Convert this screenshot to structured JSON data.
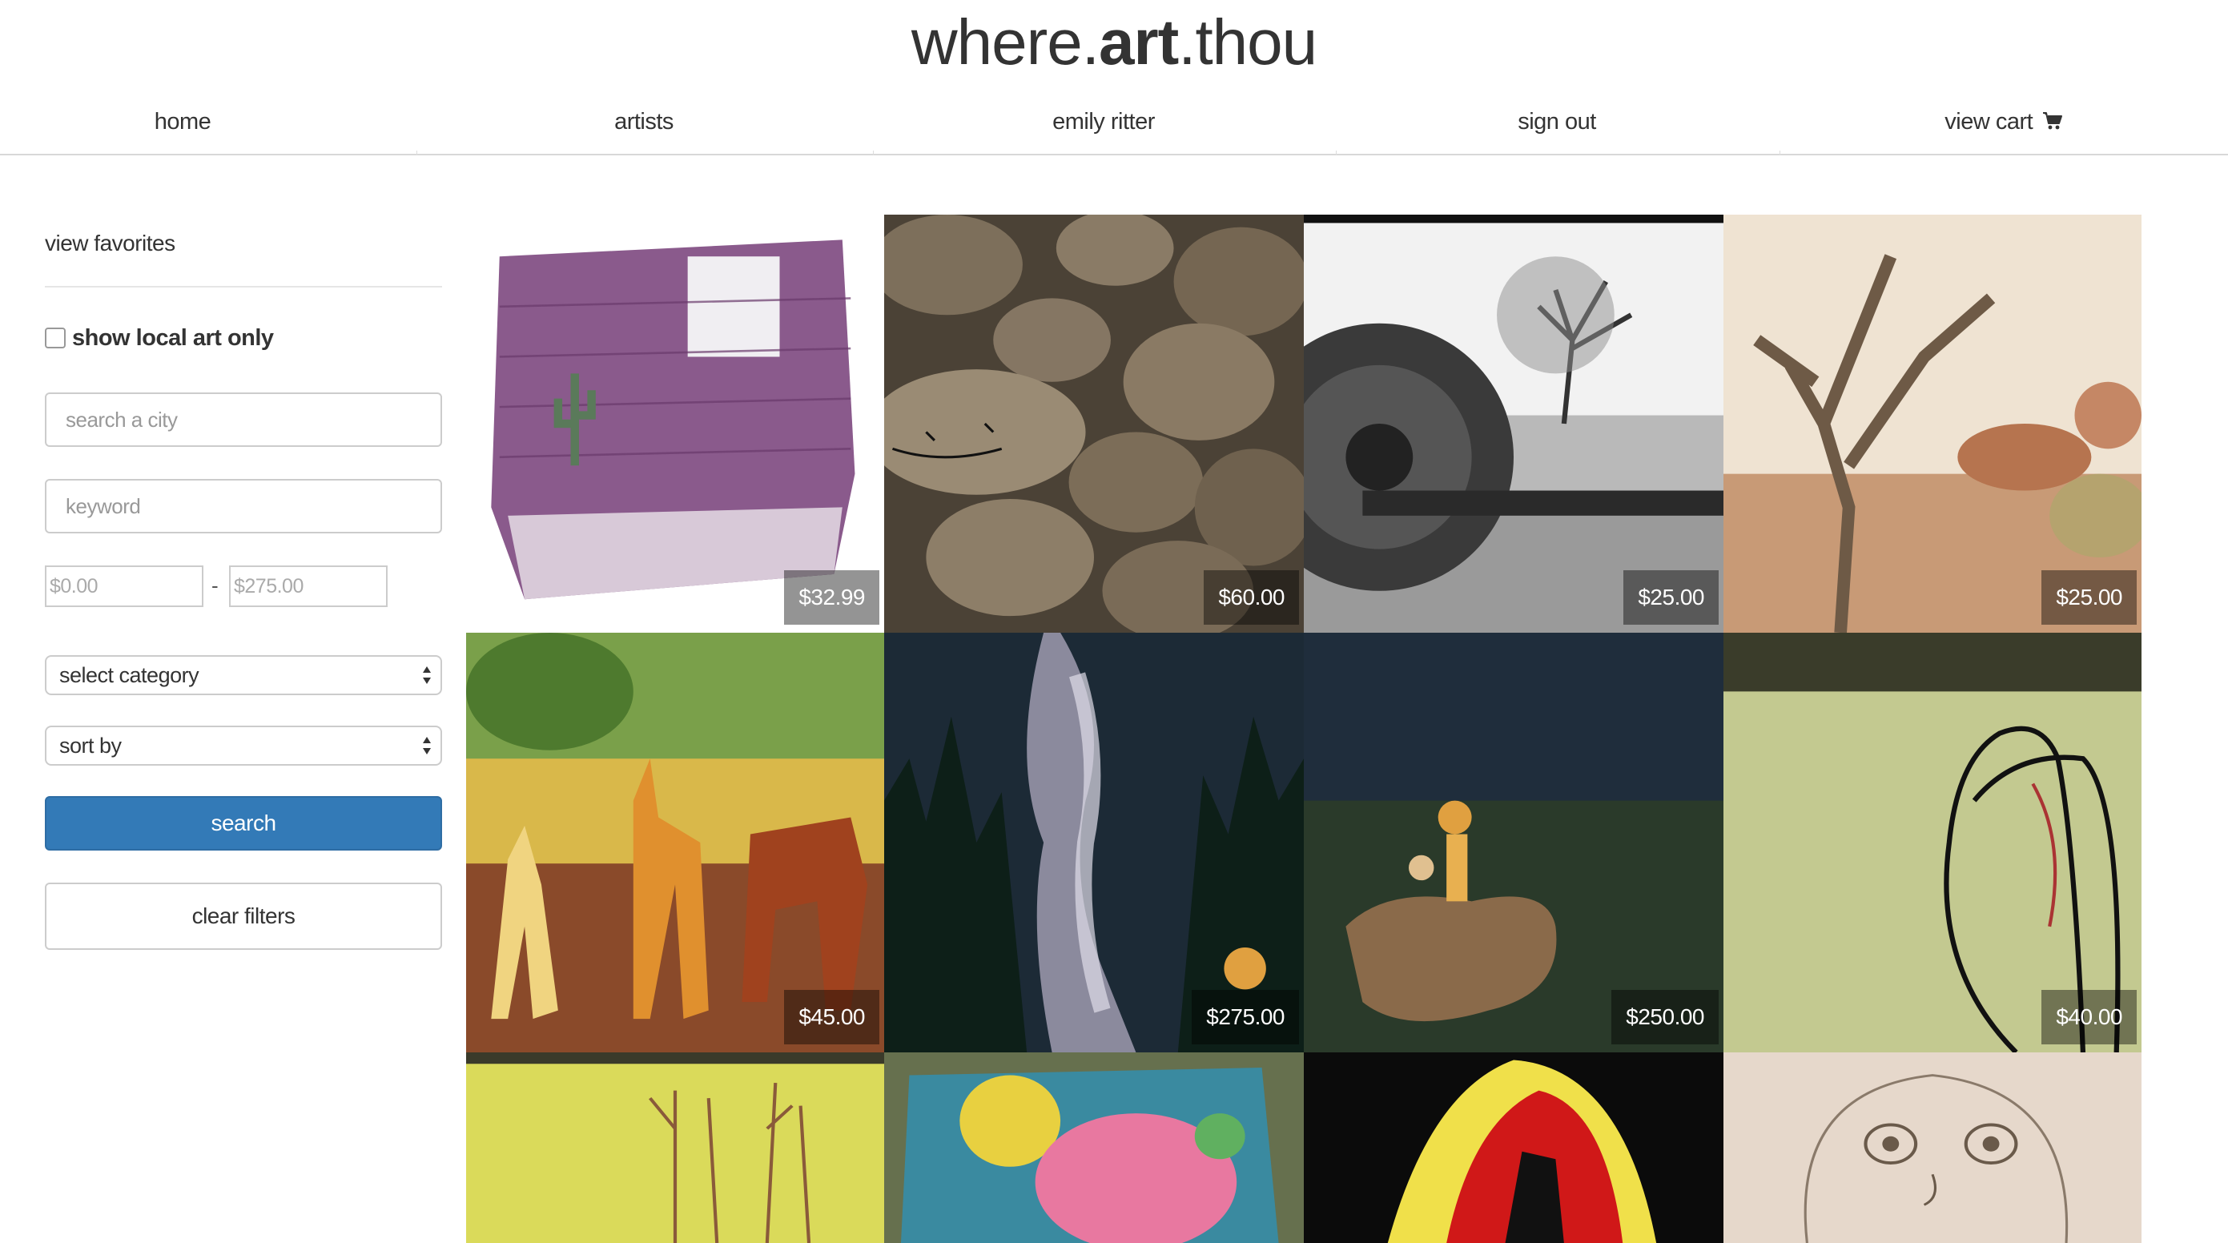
{
  "brand": {
    "prefix": "where.",
    "bold": "art",
    "suffix": ".thou"
  },
  "nav": {
    "home": "home",
    "artists": "artists",
    "user": "emily ritter",
    "signout": "sign out",
    "cart": "view cart",
    "cart_icon": "shopping-cart-icon"
  },
  "sidebar": {
    "favorites": "view favorites",
    "local_label": "show local art only",
    "local_checked": false,
    "city_placeholder": "search a city",
    "keyword_placeholder": "keyword",
    "min_price": "$0.00",
    "max_price": "$275.00",
    "range_separator": "-",
    "category_select": "select category",
    "sort_select": "sort by",
    "search_button": "search",
    "clear_button": "clear filters"
  },
  "gallery": {
    "items": [
      {
        "price": "$32.99",
        "subject": "purple brick wall with cactus and window painting"
      },
      {
        "price": "$60.00",
        "subject": "stone wall photograph with drawn face"
      },
      {
        "price": "$25.00",
        "subject": "black and white train wheel and tree photograph"
      },
      {
        "price": "$25.00",
        "subject": "desert dead tree photograph"
      },
      {
        "price": "$45.00",
        "subject": "colorful deer collage"
      },
      {
        "price": "$275.00",
        "subject": "milky way forest painting with tiger"
      },
      {
        "price": "$250.00",
        "subject": "starry night rock with boy and tiger painting"
      },
      {
        "price": "$40.00",
        "subject": "line drawing of figures on green paper"
      },
      {
        "price": "",
        "subject": "yellow painting with thin trees"
      },
      {
        "price": "",
        "subject": "colorful psychedelic face painting"
      },
      {
        "price": "",
        "subject": "red yellow black stencil face"
      },
      {
        "price": "",
        "subject": "pencil sketch of child face"
      }
    ]
  }
}
